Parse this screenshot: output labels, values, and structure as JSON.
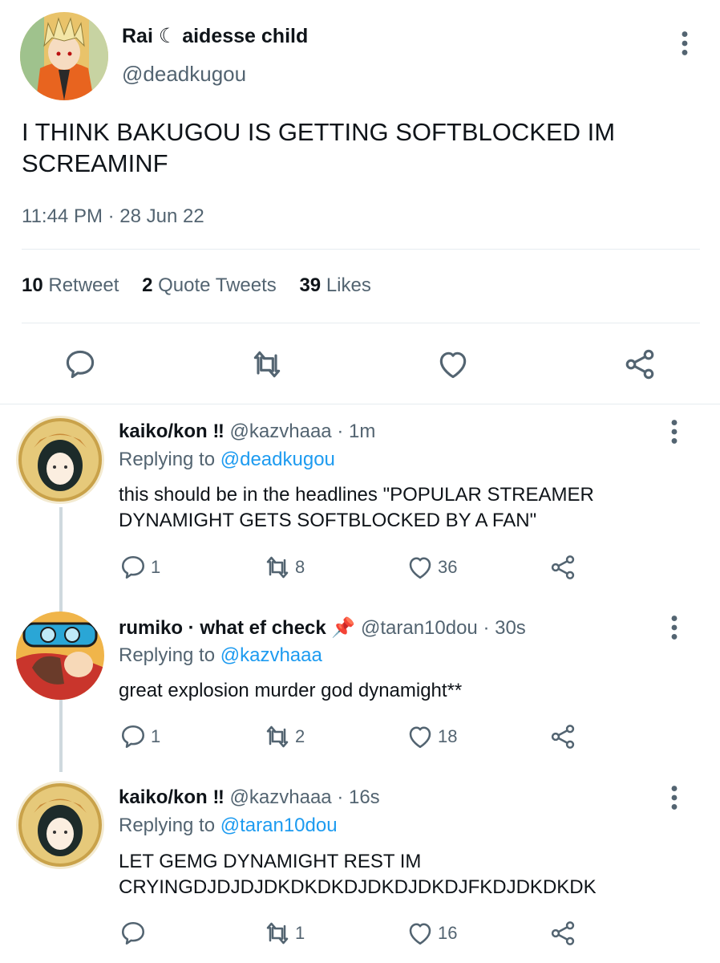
{
  "colors": {
    "accent": "#1d9bf0",
    "secondary_text": "#536471",
    "border": "#e6ecf0"
  },
  "main_tweet": {
    "name": "Rai ☾ aidesse child",
    "handle": "@deadkugou",
    "text": "I THINK BAKUGOU IS GETTING SOFTBLOCKED IM SCREAMINF",
    "timestamp": "11:44 PM · 28 Jun 22",
    "stats": [
      {
        "count": "10",
        "label": "Retweet"
      },
      {
        "count": "2",
        "label": "Quote Tweets"
      },
      {
        "count": "39",
        "label": "Likes"
      }
    ],
    "actions": [
      "reply-icon",
      "retweet-icon",
      "like-icon",
      "share-icon"
    ]
  },
  "replies": [
    {
      "name": "kaiko/kon ‼",
      "handle": "@kazvhaaa",
      "time": "· 1m",
      "replying_prefix": "Replying to",
      "replying_to": "@deadkugou",
      "text": "this should be in the headlines \"POPULAR STREAMER DYNAMIGHT GETS SOFTBLOCKED BY A FAN\"",
      "replies": "1",
      "retweets": "8",
      "likes": "36"
    },
    {
      "name": "rumiko · what ef check 📌",
      "handle": "@taran10dou",
      "time": "· 30s",
      "replying_prefix": "Replying to",
      "replying_to": "@kazvhaaa",
      "text": "great explosion murder god dynamight**",
      "replies": "1",
      "retweets": "2",
      "likes": "18"
    },
    {
      "name": "kaiko/kon ‼",
      "handle": "@kazvhaaa",
      "time": "· 16s",
      "replying_prefix": "Replying to",
      "replying_to": "@taran10dou",
      "text": "LET GEMG DYNAMIGHT REST IM CRYINGDJDJDJDKDKDKDJDKDJDKDJFKDJDKDKDK",
      "replies": "",
      "retweets": "1",
      "likes": "16"
    }
  ]
}
